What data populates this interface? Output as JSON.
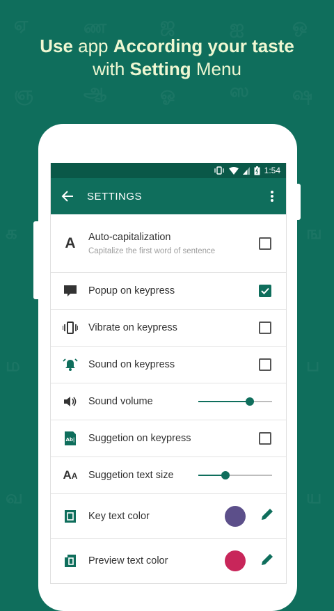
{
  "headline": {
    "line1_a": "Use",
    "line1_b": " app ",
    "line1_c": "According your taste",
    "line2_a": "with ",
    "line2_b": "Setting",
    "line2_c": " Menu"
  },
  "status_bar": {
    "time": "1:54"
  },
  "app_bar": {
    "title": "SETTINGS"
  },
  "colors": {
    "accent": "#0f6e5c",
    "key_text_color": "#5c4f8a",
    "preview_text_color": "#c8265a"
  },
  "settings": [
    {
      "icon": "letter-a-icon",
      "label": "Auto-capitalization",
      "sublabel": "Capitalize the first word of sentence",
      "type": "checkbox",
      "checked": false
    },
    {
      "icon": "popup-icon",
      "label": "Popup on keypress",
      "type": "checkbox",
      "checked": true
    },
    {
      "icon": "vibrate-icon",
      "label": "Vibrate on keypress",
      "type": "checkbox",
      "checked": false
    },
    {
      "icon": "bell-ring-icon",
      "label": "Sound on keypress",
      "type": "checkbox",
      "checked": false
    },
    {
      "icon": "volume-icon",
      "label": "Sound volume",
      "type": "slider",
      "value": 0.7
    },
    {
      "icon": "suggestion-icon",
      "label": "Suggetion on keypress",
      "type": "checkbox",
      "checked": false
    },
    {
      "icon": "text-size-icon",
      "label": "Suggetion text size",
      "type": "slider",
      "value": 0.37
    },
    {
      "icon": "key-text-color-icon",
      "label": "Key text color",
      "type": "color"
    },
    {
      "icon": "preview-text-color-icon",
      "label": "Preview text color",
      "type": "color"
    }
  ],
  "icon_glyphs": {
    "letter_a": "A",
    "abl": "Ab|",
    "text_size_big": "A",
    "text_size_small": "A"
  }
}
